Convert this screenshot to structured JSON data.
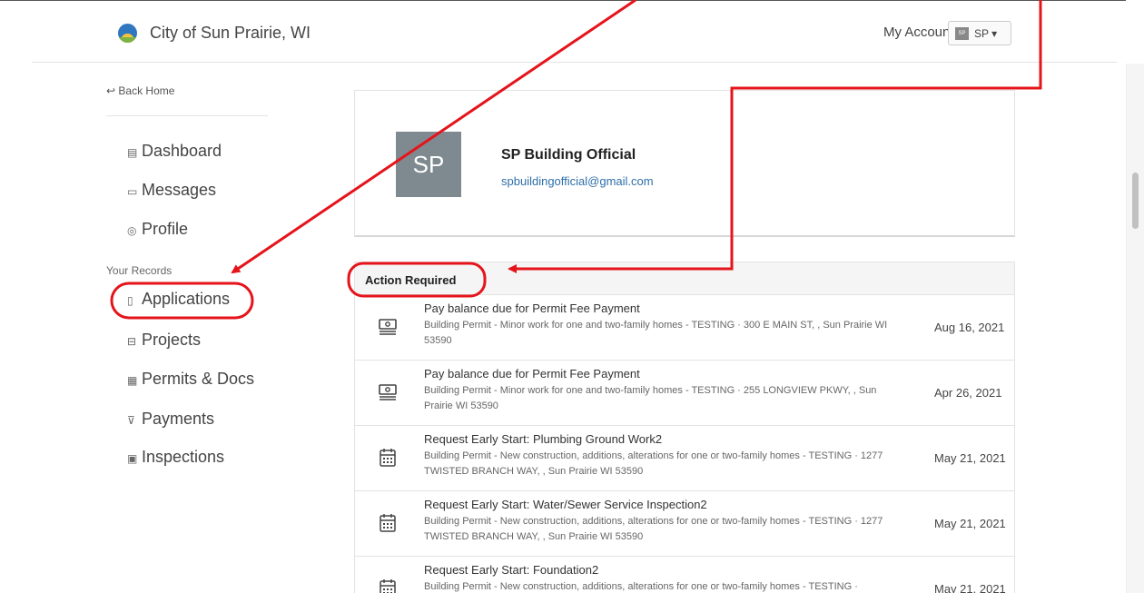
{
  "header": {
    "city_name": "City of Sun Prairie, WI",
    "my_account": "My Account",
    "account_mini": "SP",
    "account_label": "SP ▾"
  },
  "sidebar": {
    "back_home": "↩ Back Home",
    "nav": [
      {
        "label": "Dashboard",
        "icon": "dashboard-icon"
      },
      {
        "label": "Messages",
        "icon": "message-icon"
      },
      {
        "label": "Profile",
        "icon": "profile-icon"
      }
    ],
    "records_label": "Your Records",
    "records": [
      {
        "label": "Applications",
        "icon": "document-icon"
      },
      {
        "label": "Projects",
        "icon": "briefcase-icon"
      },
      {
        "label": "Permits & Docs",
        "icon": "permits-icon"
      },
      {
        "label": "Payments",
        "icon": "cart-icon"
      },
      {
        "label": "Inspections",
        "icon": "checklist-icon"
      }
    ]
  },
  "profile": {
    "initials": "SP",
    "name": "SP Building Official",
    "email": "spbuildingofficial@gmail.com"
  },
  "action_required": {
    "title": "Action Required",
    "items": [
      {
        "icon": "money-icon",
        "title": "Pay balance due for Permit Fee Payment",
        "desc": "Building Permit - Minor work for one and two-family homes - TESTING · 300 E MAIN ST, , Sun Prairie WI 53590",
        "date": "Aug 16, 2021"
      },
      {
        "icon": "money-icon",
        "title": "Pay balance due for Permit Fee Payment",
        "desc": "Building Permit - Minor work for one and two-family homes - TESTING · 255 LONGVIEW PKWY, , Sun Prairie WI 53590",
        "date": "Apr 26, 2021"
      },
      {
        "icon": "calendar-icon",
        "title": "Request Early Start: Plumbing Ground Work2",
        "desc": "Building Permit - New construction, additions, alterations for one or two-family homes - TESTING · 1277 TWISTED BRANCH WAY, , Sun Prairie WI 53590",
        "date": "May 21, 2021"
      },
      {
        "icon": "calendar-icon",
        "title": "Request Early Start: Water/Sewer Service Inspection2",
        "desc": "Building Permit - New construction, additions, alterations for one or two-family homes - TESTING · 1277 TWISTED BRANCH WAY, , Sun Prairie WI 53590",
        "date": "May 21, 2021"
      },
      {
        "icon": "calendar-icon",
        "title": "Request Early Start: Foundation2",
        "desc": "Building Permit - New construction, additions, alterations for one or two-family homes - TESTING ·",
        "date": "May 21, 2021"
      }
    ]
  },
  "colors": {
    "annotation_red": "#e5141b",
    "link_blue": "#2f6fa8",
    "avatar_gray": "#7e8a8f"
  }
}
